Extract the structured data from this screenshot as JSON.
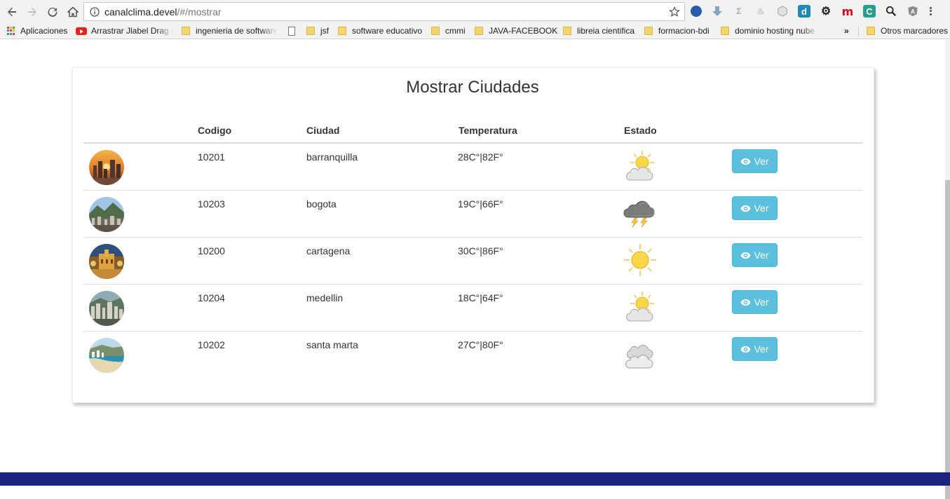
{
  "browser": {
    "url_host": "canalclima.devel",
    "url_path": "/#/mostrar",
    "bookmarks": [
      {
        "label": "Aplicaciones",
        "icon": "apps-grid-icon"
      },
      {
        "label": "Arrastrar Jlabel Drag a",
        "icon": "youtube-icon"
      },
      {
        "label": "ingenieria de software",
        "icon": "folder-icon"
      },
      {
        "label": "",
        "icon": "page-icon"
      },
      {
        "label": "jsf",
        "icon": "folder-icon"
      },
      {
        "label": "software educativo",
        "icon": "folder-icon"
      },
      {
        "label": "cmmi",
        "icon": "folder-icon"
      },
      {
        "label": "JAVA-FACEBOOK",
        "icon": "folder-icon"
      },
      {
        "label": "libreia cientifica",
        "icon": "folder-icon"
      },
      {
        "label": "formacion-bdi",
        "icon": "folder-icon"
      },
      {
        "label": "dominio hosting nube",
        "icon": "folder-icon"
      }
    ],
    "overflow": "»",
    "other_bookmarks": "Otros marcadores"
  },
  "page": {
    "title": "Mostrar Ciudades",
    "headers": {
      "codigo": "Codigo",
      "ciudad": "Ciudad",
      "temperatura": "Temperatura",
      "estado": "Estado"
    },
    "button_label": "Ver",
    "rows": [
      {
        "codigo": "10201",
        "ciudad": "barranquilla",
        "temperatura": "28C°|82F°",
        "estado": "partly-cloudy-icon"
      },
      {
        "codigo": "10203",
        "ciudad": "bogota",
        "temperatura": "19C°|66F°",
        "estado": "thunderstorm-icon"
      },
      {
        "codigo": "10200",
        "ciudad": "cartagena",
        "temperatura": "30C°|86F°",
        "estado": "sunny-icon"
      },
      {
        "codigo": "10204",
        "ciudad": "medellin",
        "temperatura": "18C°|64F°",
        "estado": "partly-cloudy-icon"
      },
      {
        "codigo": "10202",
        "ciudad": "santa marta",
        "temperatura": "27C°|80F°",
        "estado": "cloudy-icon"
      }
    ]
  },
  "colors": {
    "button": "#5bc0de",
    "footer": "#1a237e",
    "folder": "#f6d56e"
  }
}
